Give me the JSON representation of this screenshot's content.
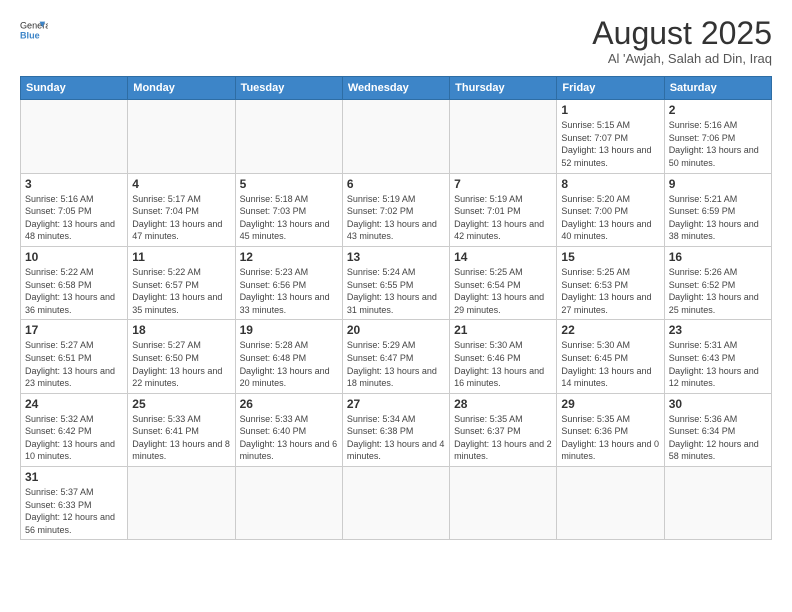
{
  "header": {
    "logo_general": "General",
    "logo_blue": "Blue",
    "title": "August 2025",
    "subtitle": "Al 'Awjah, Salah ad Din, Iraq"
  },
  "weekdays": [
    "Sunday",
    "Monday",
    "Tuesday",
    "Wednesday",
    "Thursday",
    "Friday",
    "Saturday"
  ],
  "weeks": [
    [
      {
        "day": "",
        "info": ""
      },
      {
        "day": "",
        "info": ""
      },
      {
        "day": "",
        "info": ""
      },
      {
        "day": "",
        "info": ""
      },
      {
        "day": "",
        "info": ""
      },
      {
        "day": "1",
        "info": "Sunrise: 5:15 AM\nSunset: 7:07 PM\nDaylight: 13 hours\nand 52 minutes."
      },
      {
        "day": "2",
        "info": "Sunrise: 5:16 AM\nSunset: 7:06 PM\nDaylight: 13 hours\nand 50 minutes."
      }
    ],
    [
      {
        "day": "3",
        "info": "Sunrise: 5:16 AM\nSunset: 7:05 PM\nDaylight: 13 hours\nand 48 minutes."
      },
      {
        "day": "4",
        "info": "Sunrise: 5:17 AM\nSunset: 7:04 PM\nDaylight: 13 hours\nand 47 minutes."
      },
      {
        "day": "5",
        "info": "Sunrise: 5:18 AM\nSunset: 7:03 PM\nDaylight: 13 hours\nand 45 minutes."
      },
      {
        "day": "6",
        "info": "Sunrise: 5:19 AM\nSunset: 7:02 PM\nDaylight: 13 hours\nand 43 minutes."
      },
      {
        "day": "7",
        "info": "Sunrise: 5:19 AM\nSunset: 7:01 PM\nDaylight: 13 hours\nand 42 minutes."
      },
      {
        "day": "8",
        "info": "Sunrise: 5:20 AM\nSunset: 7:00 PM\nDaylight: 13 hours\nand 40 minutes."
      },
      {
        "day": "9",
        "info": "Sunrise: 5:21 AM\nSunset: 6:59 PM\nDaylight: 13 hours\nand 38 minutes."
      }
    ],
    [
      {
        "day": "10",
        "info": "Sunrise: 5:22 AM\nSunset: 6:58 PM\nDaylight: 13 hours\nand 36 minutes."
      },
      {
        "day": "11",
        "info": "Sunrise: 5:22 AM\nSunset: 6:57 PM\nDaylight: 13 hours\nand 35 minutes."
      },
      {
        "day": "12",
        "info": "Sunrise: 5:23 AM\nSunset: 6:56 PM\nDaylight: 13 hours\nand 33 minutes."
      },
      {
        "day": "13",
        "info": "Sunrise: 5:24 AM\nSunset: 6:55 PM\nDaylight: 13 hours\nand 31 minutes."
      },
      {
        "day": "14",
        "info": "Sunrise: 5:25 AM\nSunset: 6:54 PM\nDaylight: 13 hours\nand 29 minutes."
      },
      {
        "day": "15",
        "info": "Sunrise: 5:25 AM\nSunset: 6:53 PM\nDaylight: 13 hours\nand 27 minutes."
      },
      {
        "day": "16",
        "info": "Sunrise: 5:26 AM\nSunset: 6:52 PM\nDaylight: 13 hours\nand 25 minutes."
      }
    ],
    [
      {
        "day": "17",
        "info": "Sunrise: 5:27 AM\nSunset: 6:51 PM\nDaylight: 13 hours\nand 23 minutes."
      },
      {
        "day": "18",
        "info": "Sunrise: 5:27 AM\nSunset: 6:50 PM\nDaylight: 13 hours\nand 22 minutes."
      },
      {
        "day": "19",
        "info": "Sunrise: 5:28 AM\nSunset: 6:48 PM\nDaylight: 13 hours\nand 20 minutes."
      },
      {
        "day": "20",
        "info": "Sunrise: 5:29 AM\nSunset: 6:47 PM\nDaylight: 13 hours\nand 18 minutes."
      },
      {
        "day": "21",
        "info": "Sunrise: 5:30 AM\nSunset: 6:46 PM\nDaylight: 13 hours\nand 16 minutes."
      },
      {
        "day": "22",
        "info": "Sunrise: 5:30 AM\nSunset: 6:45 PM\nDaylight: 13 hours\nand 14 minutes."
      },
      {
        "day": "23",
        "info": "Sunrise: 5:31 AM\nSunset: 6:43 PM\nDaylight: 13 hours\nand 12 minutes."
      }
    ],
    [
      {
        "day": "24",
        "info": "Sunrise: 5:32 AM\nSunset: 6:42 PM\nDaylight: 13 hours\nand 10 minutes."
      },
      {
        "day": "25",
        "info": "Sunrise: 5:33 AM\nSunset: 6:41 PM\nDaylight: 13 hours\nand 8 minutes."
      },
      {
        "day": "26",
        "info": "Sunrise: 5:33 AM\nSunset: 6:40 PM\nDaylight: 13 hours\nand 6 minutes."
      },
      {
        "day": "27",
        "info": "Sunrise: 5:34 AM\nSunset: 6:38 PM\nDaylight: 13 hours\nand 4 minutes."
      },
      {
        "day": "28",
        "info": "Sunrise: 5:35 AM\nSunset: 6:37 PM\nDaylight: 13 hours\nand 2 minutes."
      },
      {
        "day": "29",
        "info": "Sunrise: 5:35 AM\nSunset: 6:36 PM\nDaylight: 13 hours\nand 0 minutes."
      },
      {
        "day": "30",
        "info": "Sunrise: 5:36 AM\nSunset: 6:34 PM\nDaylight: 12 hours\nand 58 minutes."
      }
    ],
    [
      {
        "day": "31",
        "info": "Sunrise: 5:37 AM\nSunset: 6:33 PM\nDaylight: 12 hours\nand 56 minutes."
      },
      {
        "day": "",
        "info": ""
      },
      {
        "day": "",
        "info": ""
      },
      {
        "day": "",
        "info": ""
      },
      {
        "day": "",
        "info": ""
      },
      {
        "day": "",
        "info": ""
      },
      {
        "day": "",
        "info": ""
      }
    ]
  ]
}
